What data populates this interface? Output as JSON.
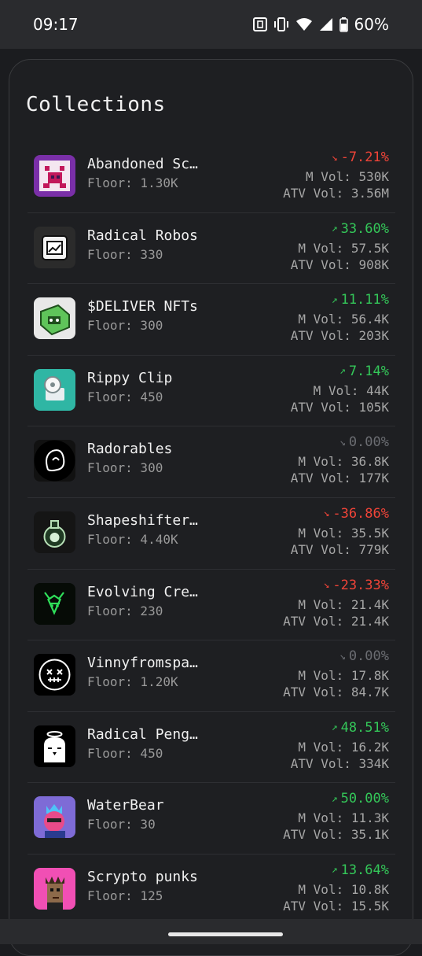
{
  "status": {
    "time": "09:17",
    "battery": "60%"
  },
  "title": "Collections",
  "collections": [
    {
      "name": "Abandoned Sc…",
      "floor": "Floor: 1.30K",
      "change": "-7.21%",
      "trend": "down",
      "m_vol": "M Vol: 530K",
      "atv_vol": "ATV Vol: 3.56M"
    },
    {
      "name": "Radical Robos",
      "floor": "Floor: 330",
      "change": "33.60%",
      "trend": "up",
      "m_vol": "M Vol: 57.5K",
      "atv_vol": "ATV Vol: 908K"
    },
    {
      "name": "$DELIVER NFTs",
      "floor": "Floor: 300",
      "change": "11.11%",
      "trend": "up",
      "m_vol": "M Vol: 56.4K",
      "atv_vol": "ATV Vol: 203K"
    },
    {
      "name": "Rippy Clip",
      "floor": "Floor: 450",
      "change": "7.14%",
      "trend": "up",
      "m_vol": "M Vol: 44K",
      "atv_vol": "ATV Vol: 105K"
    },
    {
      "name": "Radorables",
      "floor": "Floor: 300",
      "change": "0.00%",
      "trend": "flat",
      "m_vol": "M Vol: 36.8K",
      "atv_vol": "ATV Vol: 177K"
    },
    {
      "name": "Shapeshifter…",
      "floor": "Floor: 4.40K",
      "change": "-36.86%",
      "trend": "down",
      "m_vol": "M Vol: 35.5K",
      "atv_vol": "ATV Vol: 779K"
    },
    {
      "name": "Evolving Cre…",
      "floor": "Floor: 230",
      "change": "-23.33%",
      "trend": "down",
      "m_vol": "M Vol: 21.4K",
      "atv_vol": "ATV Vol: 21.4K"
    },
    {
      "name": "Vinnyfromspa…",
      "floor": "Floor: 1.20K",
      "change": "0.00%",
      "trend": "flat",
      "m_vol": "M Vol: 17.8K",
      "atv_vol": "ATV Vol: 84.7K"
    },
    {
      "name": "Radical Peng…",
      "floor": "Floor: 450",
      "change": "48.51%",
      "trend": "up",
      "m_vol": "M Vol: 16.2K",
      "atv_vol": "ATV Vol: 334K"
    },
    {
      "name": "WaterBear",
      "floor": "Floor: 30",
      "change": "50.00%",
      "trend": "up",
      "m_vol": "M Vol: 11.3K",
      "atv_vol": "ATV Vol: 35.1K"
    },
    {
      "name": "Scrypto punks",
      "floor": "Floor: 125",
      "change": "13.64%",
      "trend": "up",
      "m_vol": "M Vol: 10.8K",
      "atv_vol": "ATV Vol: 15.5K"
    }
  ],
  "colors": {
    "up": "#34c759",
    "down": "#f04438",
    "flat": "#6b6d72"
  },
  "icons": {
    "trend_up": "trending-up-icon",
    "trend_down": "trending-down-icon"
  }
}
